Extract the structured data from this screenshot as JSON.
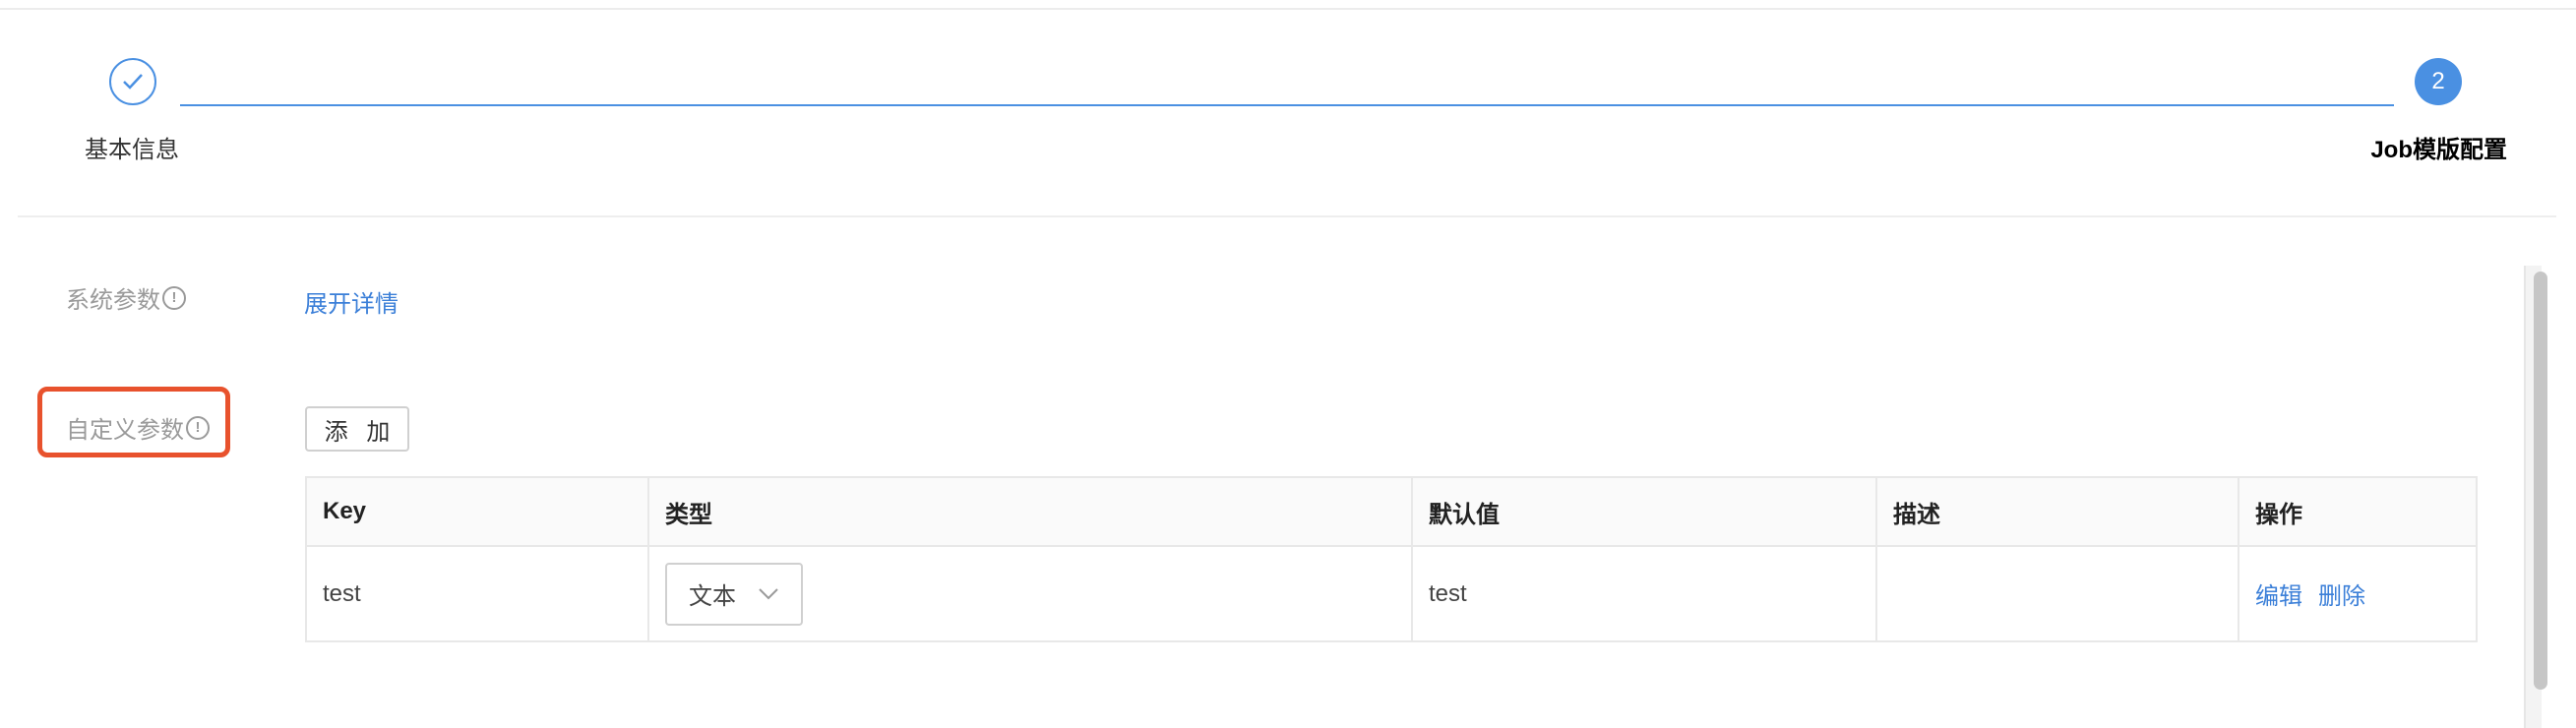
{
  "steps": [
    {
      "index": "1",
      "label": "基本信息",
      "status": "done"
    },
    {
      "index": "2",
      "label": "Job模版配置",
      "status": "active"
    }
  ],
  "system_params": {
    "label": "系统参数",
    "expand_link": "展开详情"
  },
  "custom_params": {
    "label": "自定义参数",
    "add_button": "添 加",
    "columns": [
      "Key",
      "类型",
      "默认值",
      "描述",
      "操作"
    ],
    "rows": [
      {
        "key": "test",
        "type": "文本",
        "default": "test",
        "description": "",
        "actions": [
          "编辑",
          "删除"
        ]
      }
    ]
  },
  "colors": {
    "accent": "#4a90e2",
    "link": "#3b7fd8",
    "highlight": "#e8522d"
  }
}
